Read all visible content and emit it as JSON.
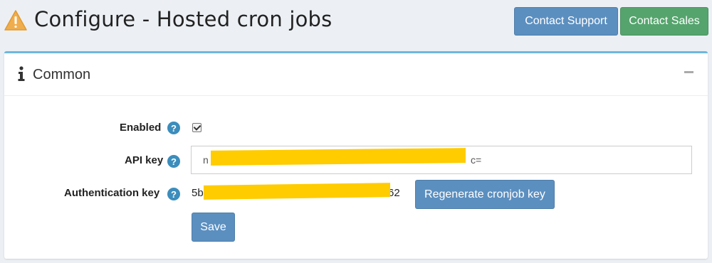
{
  "header": {
    "title": "Configure - Hosted cron jobs",
    "contact_support_label": "Contact Support",
    "contact_sales_label": "Contact Sales"
  },
  "panel": {
    "title": "Common",
    "collapse_icon": "minus-icon",
    "info_icon": "info-icon"
  },
  "form": {
    "enabled": {
      "label": "Enabled",
      "checked": true
    },
    "api_key": {
      "label": "API key",
      "value_start": "n",
      "value_end": "c="
    },
    "auth_key": {
      "label": "Authentication key",
      "value_start": "5b",
      "value_end": "62"
    },
    "regenerate_label": "Regenerate cronjob key",
    "save_label": "Save",
    "help_glyph": "?"
  },
  "colors": {
    "primary": "#5b8fc0",
    "success": "#55a46d",
    "panel_accent": "#6fb7dd",
    "help": "#3c8dbc",
    "redaction": "#ffcc00",
    "warning": "#f0ad4e"
  }
}
